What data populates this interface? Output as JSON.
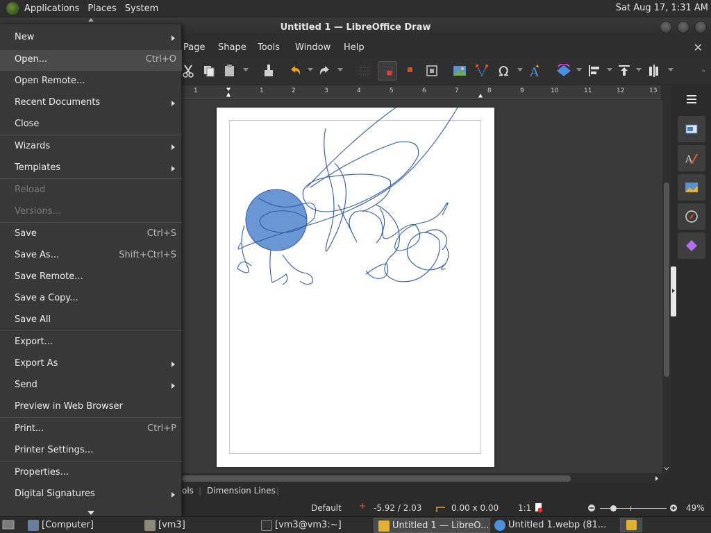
{
  "system_panel": {
    "menus": [
      "Applications",
      "Places",
      "System"
    ],
    "clock": "Sat Aug 17,  1:31 AM"
  },
  "window": {
    "title": "Untitled 1 — LibreOffice Draw"
  },
  "menubar": {
    "items": [
      "Page",
      "Shape",
      "Tools",
      "Window",
      "Help"
    ],
    "close": "✕"
  },
  "ruler": {
    "ticks": [
      "1",
      "1",
      "2",
      "3",
      "4",
      "5",
      "6",
      "7",
      "8",
      "9",
      "10",
      "11",
      "12",
      "13"
    ]
  },
  "file_menu": {
    "items": [
      {
        "label": "New",
        "submenu": true
      },
      {
        "label": "Open...",
        "shortcut": "Ctrl+O"
      },
      {
        "label": "Open Remote..."
      },
      {
        "label": "Recent Documents",
        "submenu": true
      },
      {
        "label": "Close"
      },
      {
        "label": "Wizards",
        "submenu": true
      },
      {
        "label": "Templates",
        "submenu": true
      },
      {
        "label": "Reload",
        "disabled": true
      },
      {
        "label": "Versions...",
        "disabled": true
      },
      {
        "label": "Save",
        "shortcut": "Ctrl+S"
      },
      {
        "label": "Save As...",
        "shortcut": "Shift+Ctrl+S"
      },
      {
        "label": "Save Remote..."
      },
      {
        "label": "Save a Copy..."
      },
      {
        "label": "Save All"
      },
      {
        "label": "Export..."
      },
      {
        "label": "Export As",
        "submenu": true
      },
      {
        "label": "Send",
        "submenu": true
      },
      {
        "label": "Preview in Web Browser"
      },
      {
        "label": "Print...",
        "shortcut": "Ctrl+P"
      },
      {
        "label": "Printer Settings..."
      },
      {
        "label": "Properties..."
      },
      {
        "label": "Digital Signatures",
        "submenu": true
      }
    ]
  },
  "tabs": {
    "partial": "ols",
    "dimension": "Dimension Lines",
    "divider": "|"
  },
  "statusbar": {
    "layout": "Default",
    "position": "-5.92 / 2.03",
    "size": "0.00 x 0.00",
    "scale": "1:1",
    "zoom": "49%"
  },
  "taskbar": {
    "tasks": [
      "[Computer]",
      "[vm3]",
      "[vm3@vm3:~]",
      "Untitled 1 — LibreO...",
      "Untitled 1.webp (81..."
    ]
  },
  "colors": {
    "accent": "#5b8fd0",
    "scribble": "#2f5a9e",
    "circle_fill": "#6a96d4"
  }
}
